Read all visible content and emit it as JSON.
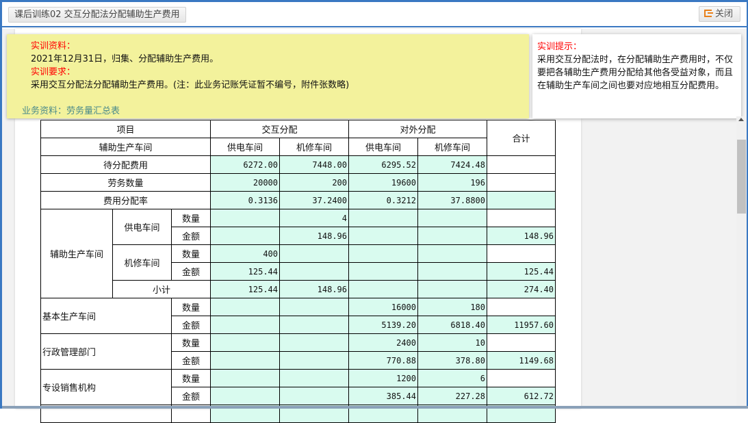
{
  "header": {
    "title": "课后训练02 交互分配法分配辅助生产费用",
    "close_label": "关闭",
    "close_icon": "exit-icon"
  },
  "info": {
    "material_label": "实训资料：",
    "material_text": "2021年12月31日，归集、分配辅助生产费用。",
    "requirement_label": "实训要求：",
    "requirement_text": "采用交互分配法分配辅助生产费用。(注：此业务记账凭证暂不编号，附件张数略)",
    "business_label": "业务资料：劳务量汇总表"
  },
  "hint": {
    "label": "实训提示：",
    "text": "采用交互分配法时，在分配辅助生产费用时，不仅要把各辅助生产费用分配给其他各受益对象，而且在辅助生产车间之间也要对应地相互分配费用。"
  },
  "colors": {
    "accent": "#3a78c2",
    "note_bg": "#f3f29c",
    "cell_bg": "#d9fbef",
    "label_red": "#ff0000"
  },
  "table": {
    "h_item": "项目",
    "h_mutual": "交互分配",
    "h_external": "对外分配",
    "h_total": "合计",
    "h_aux": "辅助生产车间",
    "h_power": "供电车间",
    "h_repair": "机修车间",
    "pending": {
      "label": "待分配费用",
      "v": [
        "6272.00",
        "7448.00",
        "6295.52",
        "7424.48",
        ""
      ]
    },
    "labor": {
      "label": "劳务数量",
      "v": [
        "20000",
        "200",
        "19600",
        "196",
        ""
      ]
    },
    "rate": {
      "label": "费用分配率",
      "v": [
        "0.3136",
        "37.2400",
        "0.3212",
        "37.8800",
        ""
      ]
    },
    "aux_label": "辅助生产车间",
    "qty": "数量",
    "amt": "金额",
    "subtotal": "小计",
    "power_qty": [
      "",
      "4",
      "",
      "",
      ""
    ],
    "power_amt": [
      "",
      "148.96",
      "",
      "",
      "148.96"
    ],
    "repair_qty": [
      "400",
      "",
      "",
      "",
      ""
    ],
    "repair_amt": [
      "125.44",
      "",
      "",
      "",
      "125.44"
    ],
    "sub": [
      "125.44",
      "148.96",
      "",
      "",
      "274.40"
    ],
    "basic": {
      "label": "基本生产车间",
      "qty": [
        "",
        "",
        "16000",
        "180",
        ""
      ],
      "amt": [
        "",
        "",
        "5139.20",
        "6818.40",
        "11957.60"
      ]
    },
    "admin": {
      "label": "行政管理部门",
      "qty": [
        "",
        "",
        "2400",
        "10",
        ""
      ],
      "amt": [
        "",
        "",
        "770.88",
        "378.80",
        "1149.68"
      ]
    },
    "sales": {
      "label": "专设销售机构",
      "qty": [
        "",
        "",
        "1200",
        "6",
        ""
      ],
      "amt": [
        "",
        "",
        "385.44",
        "227.28",
        "612.72"
      ]
    }
  }
}
